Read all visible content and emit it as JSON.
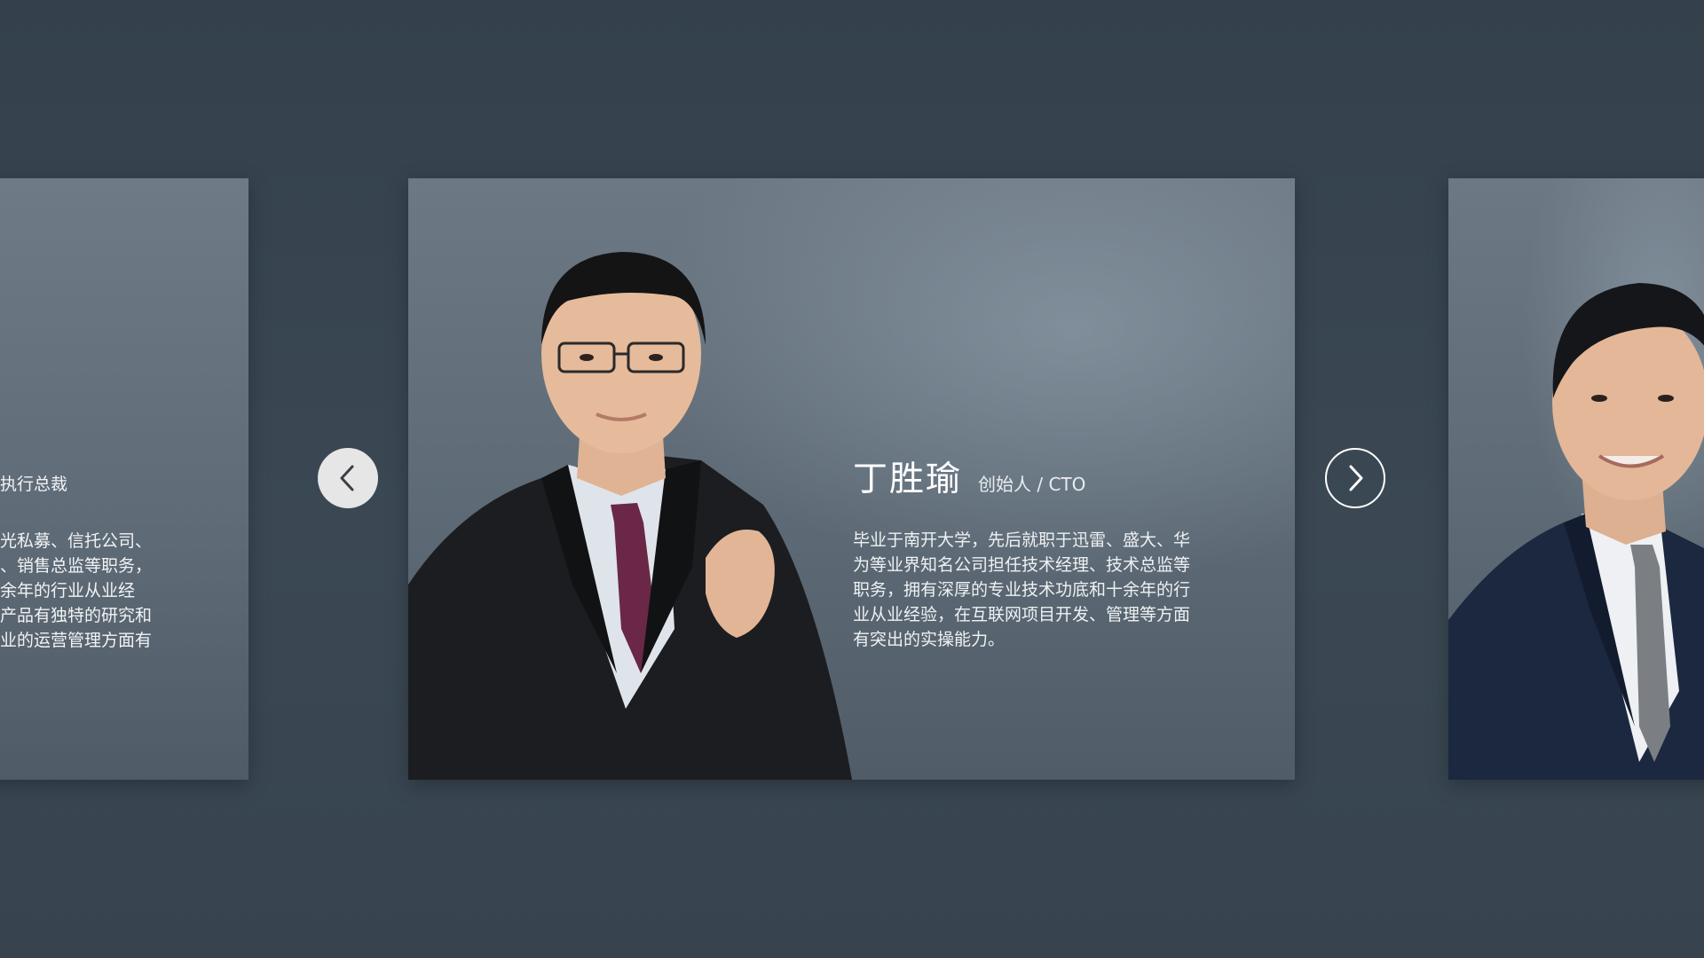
{
  "carousel": {
    "left_card": {
      "role": "执行总裁",
      "bio": "光私募、信托公司、\n、销售总监等职务，\n余年的行业从业经\n产品有独特的研究和\n业的运营管理方面有"
    },
    "center_card": {
      "name": "丁胜瑜",
      "role": "创始人 / CTO",
      "bio": "毕业于南开大学，先后就职于迅雷、盛大、华\n为等业界知名公司担任技术经理、技术总监等\n职务，拥有深厚的专业技术功底和十余年的行\n业从业经验，在互联网项目开发、管理等方面\n有突出的实操能力。"
    },
    "nav": {
      "prev_icon": "chevron-left-icon",
      "next_icon": "chevron-right-icon"
    }
  },
  "colors": {
    "background": "#37444f",
    "card": "#66727e",
    "text": "#ffffff",
    "prev_button": "#e6e6e6"
  }
}
